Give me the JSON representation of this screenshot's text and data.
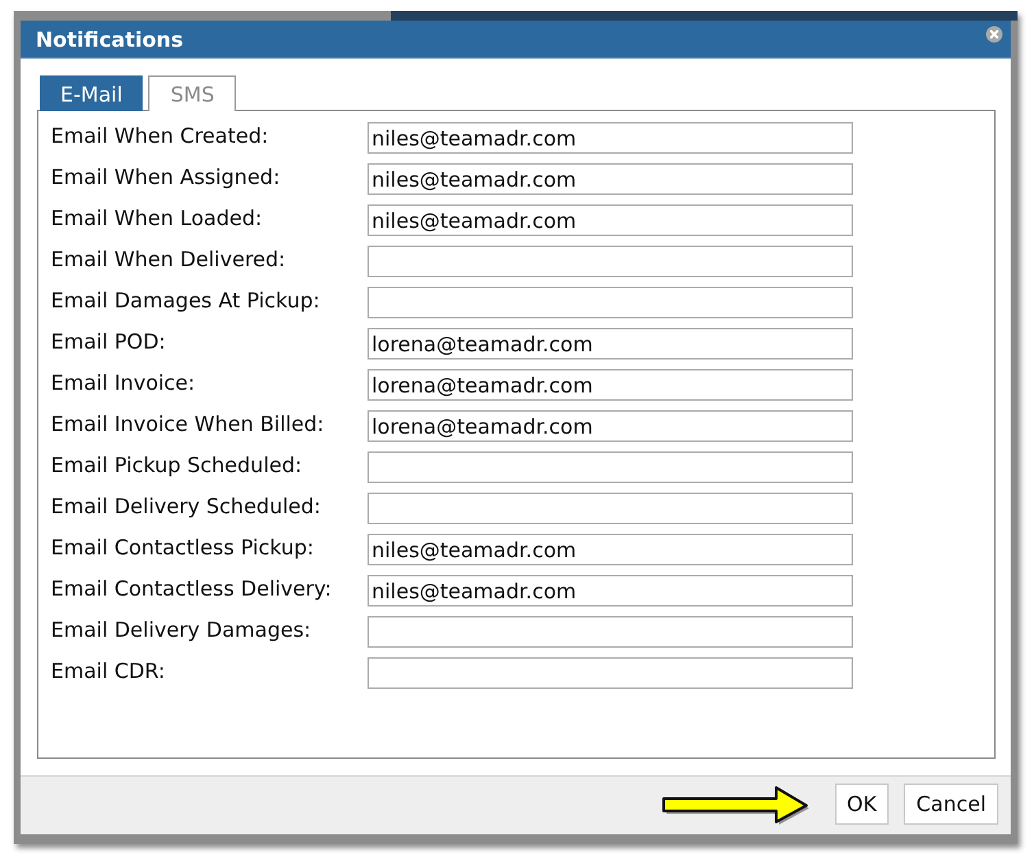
{
  "window": {
    "title": "Notifications"
  },
  "tabs": [
    {
      "label": "E-Mail",
      "selected": true
    },
    {
      "label": "SMS",
      "selected": false
    }
  ],
  "fields": [
    {
      "label": "Email When Created:",
      "value": "niles@teamadr.com"
    },
    {
      "label": "Email When Assigned:",
      "value": "niles@teamadr.com"
    },
    {
      "label": "Email When Loaded:",
      "value": "niles@teamadr.com"
    },
    {
      "label": "Email When Delivered:"
    },
    {
      "label": "Email Damages At Pickup:"
    },
    {
      "label": "Email POD:",
      "value": "lorena@teamadr.com"
    },
    {
      "label": "Email Invoice:",
      "value": "lorena@teamadr.com"
    },
    {
      "label": "Email Invoice When Billed:",
      "value": "lorena@teamadr.com"
    },
    {
      "label": "Email Pickup Scheduled:"
    },
    {
      "label": "Email Delivery Scheduled:"
    },
    {
      "label": "Email Contactless Pickup:",
      "value": "niles@teamadr.com"
    },
    {
      "label": "Email Contactless Delivery:",
      "value": "niles@teamadr.com"
    },
    {
      "label": "Email Delivery Damages:"
    },
    {
      "label": "Email CDR:"
    }
  ],
  "pointer_arrow": true,
  "buttons": [
    {
      "label": "OK"
    },
    {
      "label": "Cancel"
    }
  ]
}
